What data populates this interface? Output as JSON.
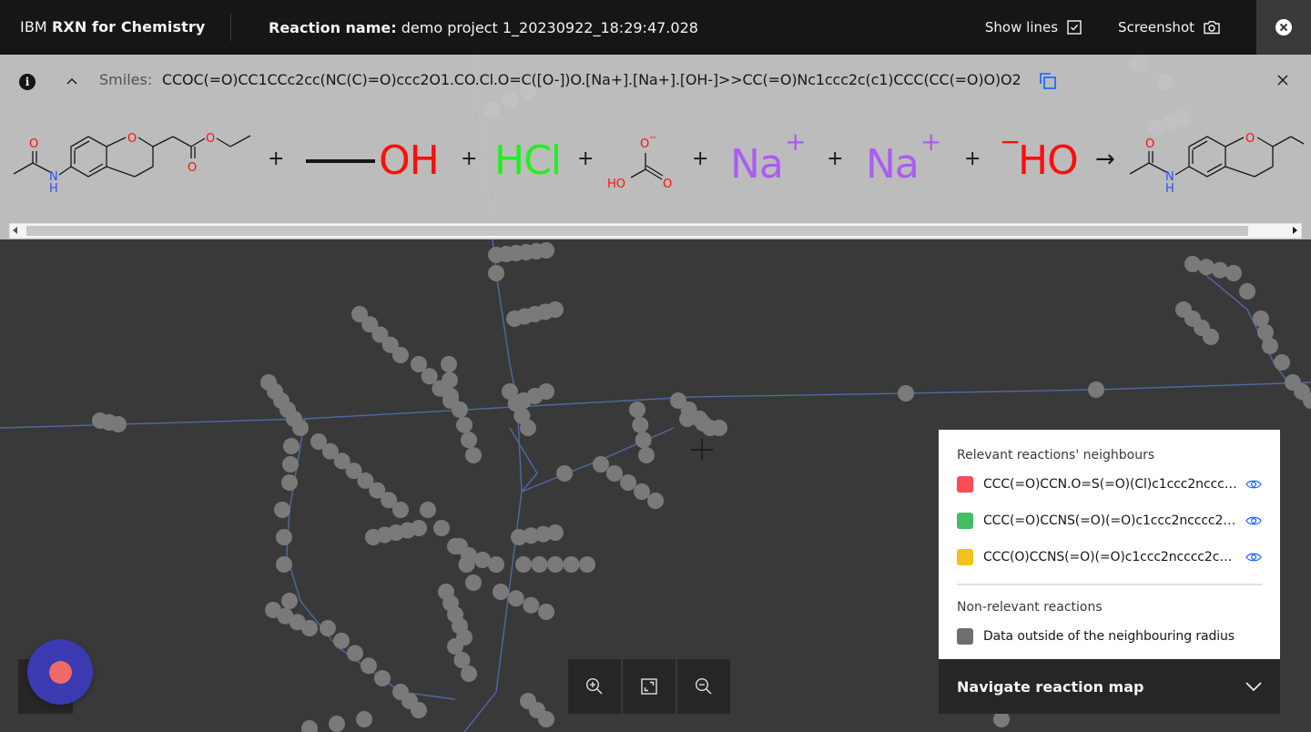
{
  "header": {
    "brand_prefix": "IBM",
    "brand_name": "RXN for Chemistry",
    "reaction_name_label": "Reaction name:",
    "reaction_name_value": "demo project 1_20230922_18:29:47.028",
    "show_lines_label": "Show lines",
    "show_lines_checked": true,
    "screenshot_label": "Screenshot"
  },
  "reaction": {
    "smiles_label": "Smiles:",
    "smiles_value": "CCOC(=O)CC1CCc2cc(NC(C)=O)ccc2O1.CO.Cl.O=C([O-])O.[Na+].[Na+].[OH-]>>CC(=O)Nc1ccc2c(c1)CCC(CC(=O)O)O2",
    "equation": {
      "plus": "+",
      "arrow": "→",
      "methanol_label": "OH",
      "hcl_label": "HCl",
      "sodium_label": "Na",
      "sodium_charge": "+",
      "hydroxide_charge": "−",
      "hydroxide_label": "HO",
      "atom_O": "O",
      "atom_N": "N",
      "atom_H": "H",
      "atom_HO": "HO",
      "atom_minus": "−"
    },
    "colors": {
      "oxygen": "#ff0d0d",
      "nitrogen": "#3050f8",
      "chlorine": "#1ff01f",
      "sodium": "#ab5cf2",
      "bond": "#161616"
    }
  },
  "legend": {
    "relevant_title": "Relevant reactions' neighbours",
    "relevant_items": [
      {
        "label": "CCC(=O)CCN.O=S(=O)(Cl)c1ccc2ncccc2...",
        "color": "#fa4d56"
      },
      {
        "label": "CCC(=O)CCNS(=O)(=O)c1ccc2ncccc2c1...",
        "color": "#42be65"
      },
      {
        "label": "CCC(O)CCNS(=O)(=O)c1ccc2ncccc2c1>...",
        "color": "#f1c21b"
      }
    ],
    "nonrelevant_title": "Non-relevant reactions",
    "nonrelevant_items": [
      {
        "label": "Data outside of the neighbouring radius",
        "color": "#6f6f6f"
      }
    ]
  },
  "navigate": {
    "label": "Navigate reaction map"
  },
  "map": {
    "background": "#393939",
    "node_color": "#7a7a7a",
    "edge_color": "#4f6aa6"
  }
}
